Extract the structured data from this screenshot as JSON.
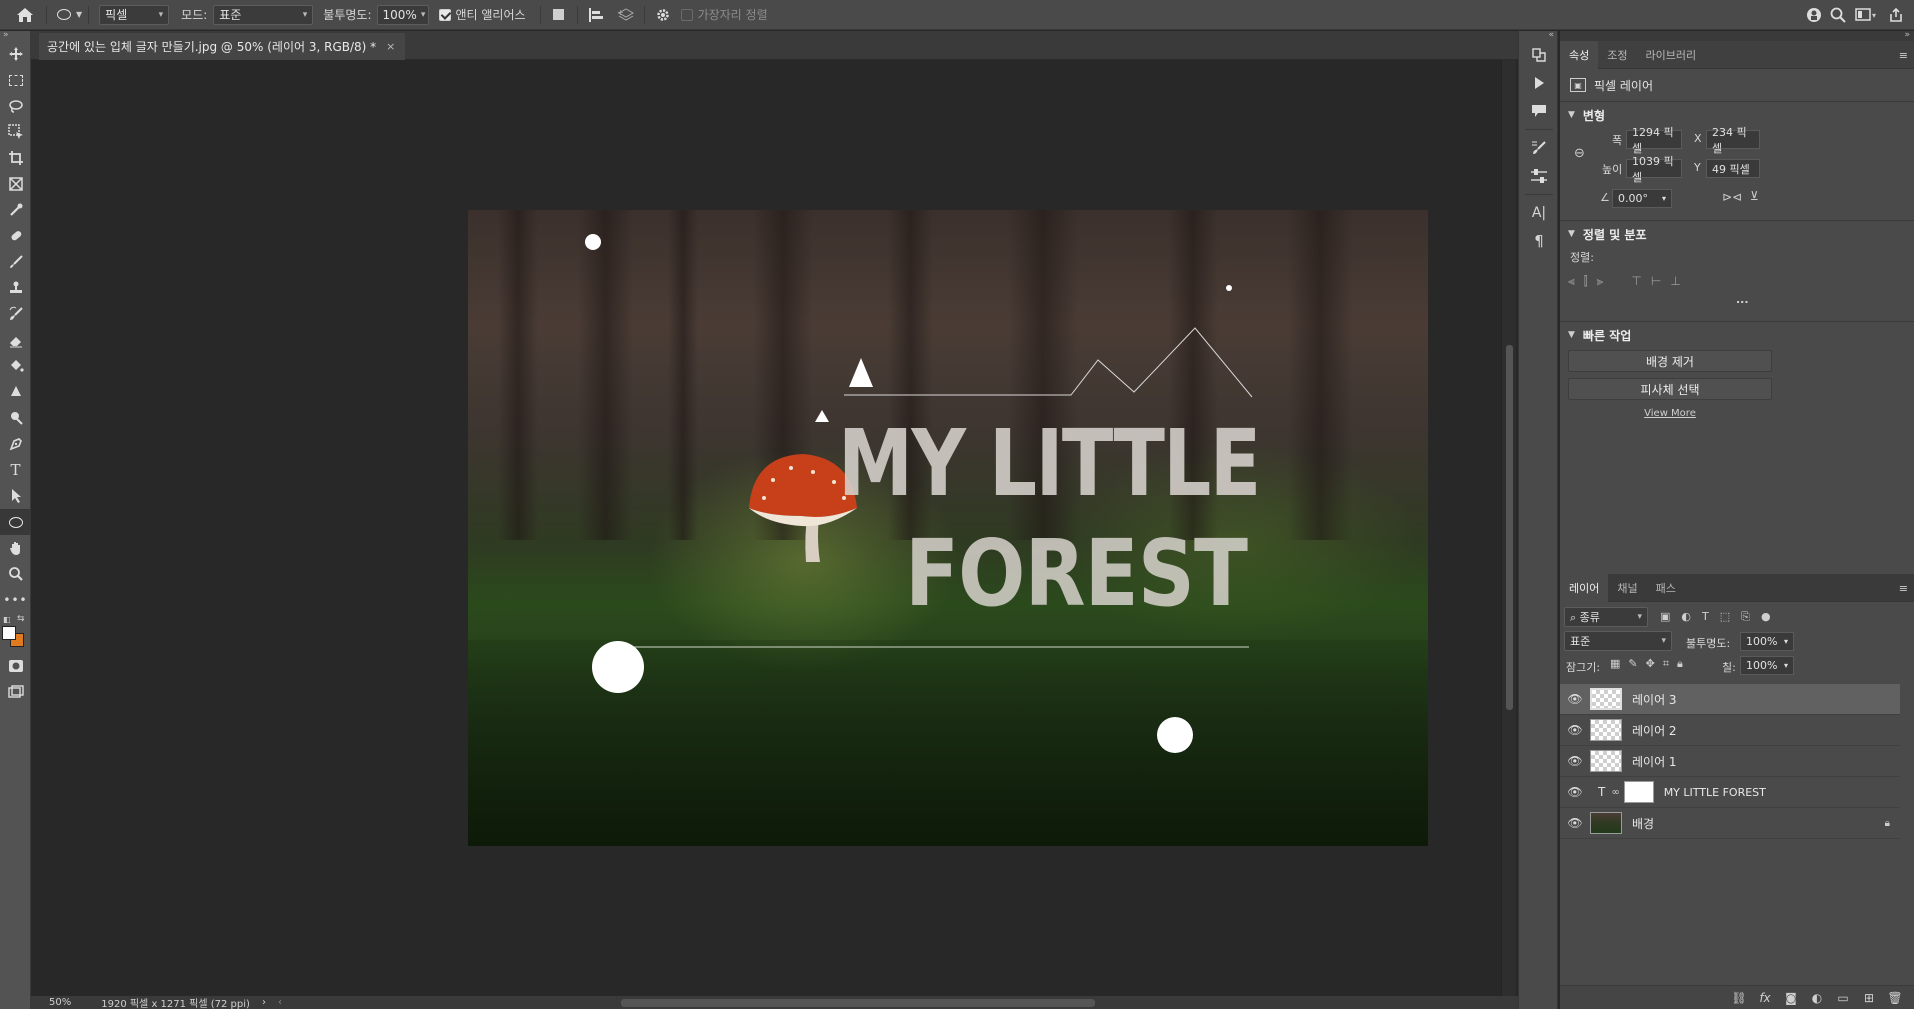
{
  "options_bar": {
    "home_icon": "home-icon",
    "shape_icon": "ellipse-icon",
    "pixel_mode": "픽셀",
    "mode_label": "모드:",
    "mode_value": "표준",
    "opacity_label": "불투명도:",
    "opacity_value": "100%",
    "antialias_label": "앤티 앨리어스",
    "align_edges_label": "가장자리 정렬"
  },
  "document": {
    "tab_title": "공간에 있는 입체 글자 만들기.jpg @ 50% (레이어 3, RGB/8) *",
    "close": "×"
  },
  "artwork": {
    "line1": "MY LITTLE",
    "line2": "FOREST"
  },
  "status": {
    "zoom": "50%",
    "doc_info": "1920 픽셀 x 1271 픽셀 (72 ppi)",
    "arrow": "›"
  },
  "properties_panel": {
    "tabs": [
      "속성",
      "조정",
      "라이브러리"
    ],
    "layer_kind": "픽셀 레이어",
    "transform": {
      "title": "변형",
      "w_label": "폭",
      "w_value": "1294 픽셀",
      "x_label": "X",
      "x_value": "234 픽셀",
      "h_label": "높이",
      "h_value": "1039 픽셀",
      "y_label": "Y",
      "y_value": "49 픽셀",
      "angle_value": "0.00°"
    },
    "align": {
      "title": "정렬 및 분포",
      "label": "정렬:",
      "more": "..."
    },
    "quick_actions": {
      "title": "빠른 작업",
      "remove_bg": "배경 제거",
      "select_subject": "피사체 선택",
      "view_more": "View More"
    }
  },
  "layers_panel": {
    "tabs": [
      "레이어",
      "채널",
      "패스"
    ],
    "filter_kind": "종류",
    "blend_mode": "표준",
    "opacity_label": "불투명도:",
    "opacity_value": "100%",
    "lock_label": "잠그기:",
    "fill_label": "칠:",
    "fill_value": "100%",
    "layers": [
      {
        "name": "레이어 3"
      },
      {
        "name": "레이어 2"
      },
      {
        "name": "레이어 1"
      },
      {
        "name": "MY LITTLE FOREST",
        "type_glyph": "T"
      },
      {
        "name": "배경"
      }
    ]
  },
  "colors": {
    "foreground": "#ffffff",
    "background": "#e07a1f"
  }
}
